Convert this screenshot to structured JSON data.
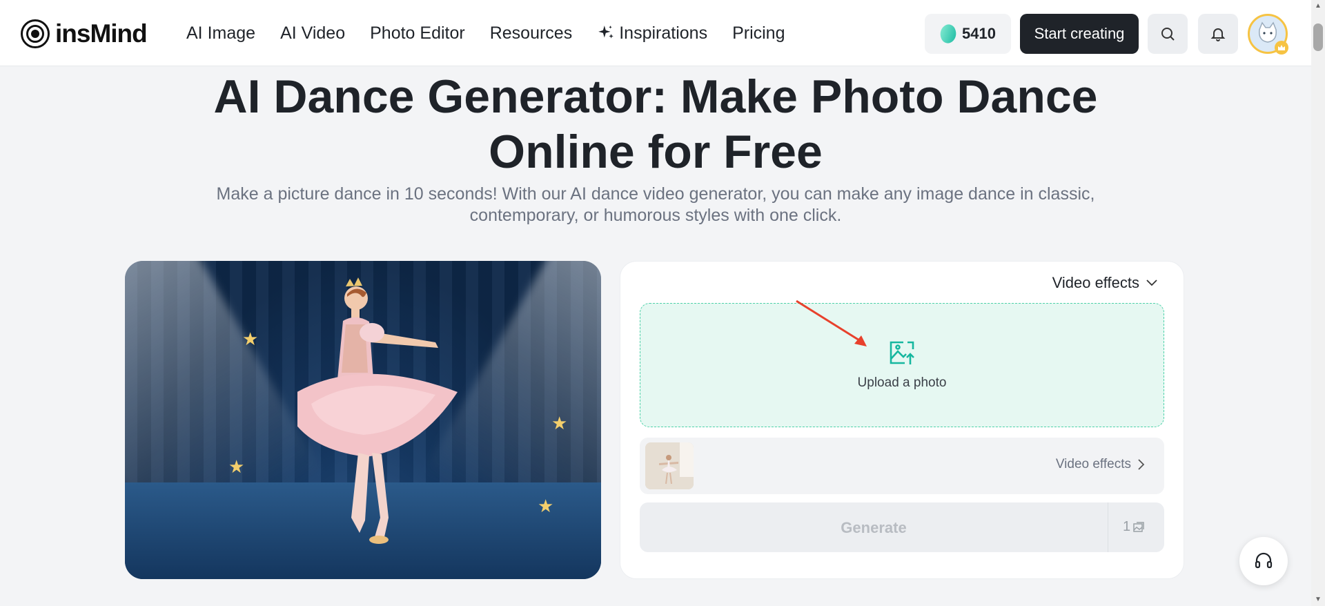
{
  "brand": {
    "name": "insMind"
  },
  "nav": {
    "items": [
      {
        "label": "AI Image"
      },
      {
        "label": "AI Video"
      },
      {
        "label": "Photo Editor"
      },
      {
        "label": "Resources"
      },
      {
        "label": "Inspirations",
        "icon": "sparkle-icon"
      },
      {
        "label": "Pricing"
      }
    ]
  },
  "header": {
    "credits": "5410",
    "start_label": "Start creating"
  },
  "hero": {
    "title": "AI Dance Generator: Make Photo Dance Online for Free",
    "subtitle": "Make a picture dance in 10 seconds! With our AI dance video generator, you can make any image dance in classic, contemporary, or humorous styles with one click."
  },
  "panel": {
    "effects_select": "Video effects",
    "upload_label": "Upload a photo",
    "effect_link": "Video effects",
    "generate_label": "Generate",
    "generate_count": "1"
  },
  "colors": {
    "accent": "#16b79f",
    "upload_bg": "#e6f8f2",
    "dark_button": "#1f2329",
    "annotation_arrow": "#e8412c"
  }
}
